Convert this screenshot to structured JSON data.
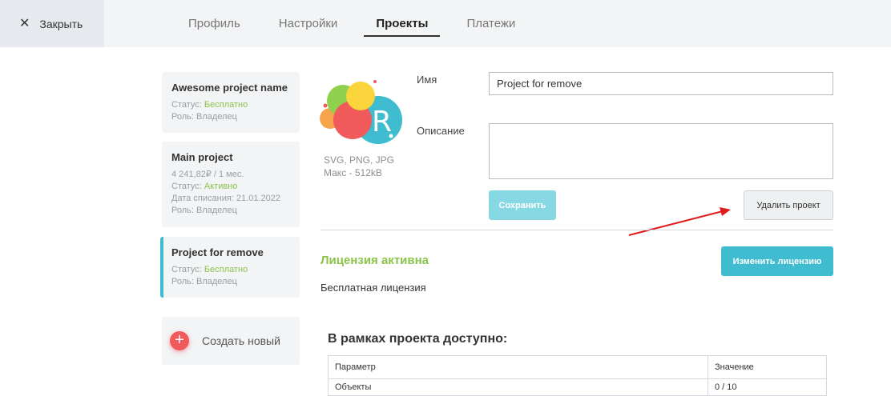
{
  "header": {
    "close_label": "Закрыть",
    "tabs": [
      {
        "label": "Профиль"
      },
      {
        "label": "Настройки"
      },
      {
        "label": "Проекты"
      },
      {
        "label": "Платежи"
      }
    ]
  },
  "projects": [
    {
      "name": "Awesome project name",
      "status_prefix": "Статус:",
      "status_value": "Бесплатно",
      "role": "Роль: Владелец"
    },
    {
      "name": "Main project",
      "price": "4 241,82₽ / 1 мес.",
      "status_prefix": "Статус:",
      "status_value": "Активно",
      "writeoff": "Дата списания: 21.01.2022",
      "role": "Роль: Владелец"
    },
    {
      "name": "Project for remove",
      "status_prefix": "Статус:",
      "status_value": "Бесплатно",
      "role": "Роль: Владелец"
    }
  ],
  "create_label": "Создать новый",
  "logo_note": {
    "formats": "SVG, PNG, JPG",
    "max": "Макс - 512kB"
  },
  "form": {
    "name_label": "Имя",
    "name_value": "Project for remove",
    "desc_label": "Описание",
    "desc_value": "",
    "save_label": "Сохранить",
    "delete_label": "Удалить проект"
  },
  "license": {
    "title": "Лицензия активна",
    "type": "Бесплатная лицензия",
    "change_label": "Изменить лицензию"
  },
  "available": {
    "title": "В рамках проекта доступно:",
    "headers": [
      "Параметр",
      "Значение"
    ],
    "rows": [
      [
        "Объекты",
        "0 / 10"
      ]
    ]
  },
  "colors": {
    "accent": "#3fbccf",
    "green": "#8bc34a",
    "red_arrow": "#e01b1b"
  }
}
